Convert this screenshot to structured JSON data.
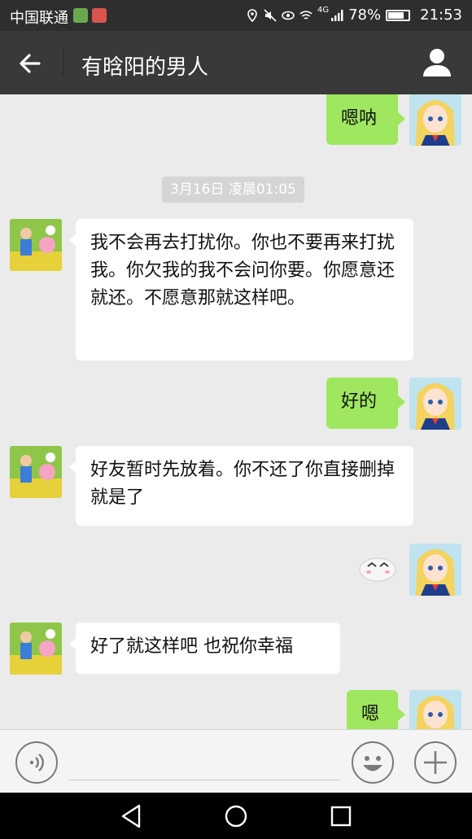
{
  "status_bar": {
    "carrier": "中国联通",
    "network": "4G",
    "battery": "78%",
    "battery_fraction": 0.78,
    "time": "21:53",
    "icons": [
      "location-icon",
      "mute-icon",
      "eye-icon",
      "wifi-icon",
      "signal-icon",
      "battery-icon"
    ]
  },
  "header": {
    "title": "有晗阳的男人",
    "back_icon": "arrow-left-icon",
    "profile_icon": "person-icon"
  },
  "chat": {
    "timestamp": "3月16日 凌晨01:05",
    "messages": [
      {
        "direction": "out",
        "type": "text",
        "text": "嗯呐"
      },
      {
        "direction": "in",
        "type": "text",
        "text": "我不会再去打扰你。你也不要再来打扰我。你欠我的我不会问你要。你愿意还就还。不愿意那就这样吧。"
      },
      {
        "direction": "out",
        "type": "text",
        "text": "好的"
      },
      {
        "direction": "in",
        "type": "text",
        "text": "好友暂时先放着。你不还了你直接删掉就是了"
      },
      {
        "direction": "out",
        "type": "sticker",
        "text": ""
      },
      {
        "direction": "in",
        "type": "text",
        "text": "好了就这样吧 也祝你幸福"
      },
      {
        "direction": "out",
        "type": "text",
        "text": "嗯"
      }
    ]
  },
  "input_bar": {
    "placeholder": "",
    "voice_icon": "voice-icon",
    "emoji_icon": "emoji-icon",
    "plus_icon": "plus-icon"
  },
  "nav_bar": {
    "icons": [
      "back-triangle-icon",
      "home-circle-icon",
      "recents-square-icon"
    ]
  },
  "colors": {
    "header_bg": "#393939",
    "chat_bg": "#ebebeb",
    "out_bubble": "#9fe75f",
    "in_bubble": "#ffffff"
  }
}
